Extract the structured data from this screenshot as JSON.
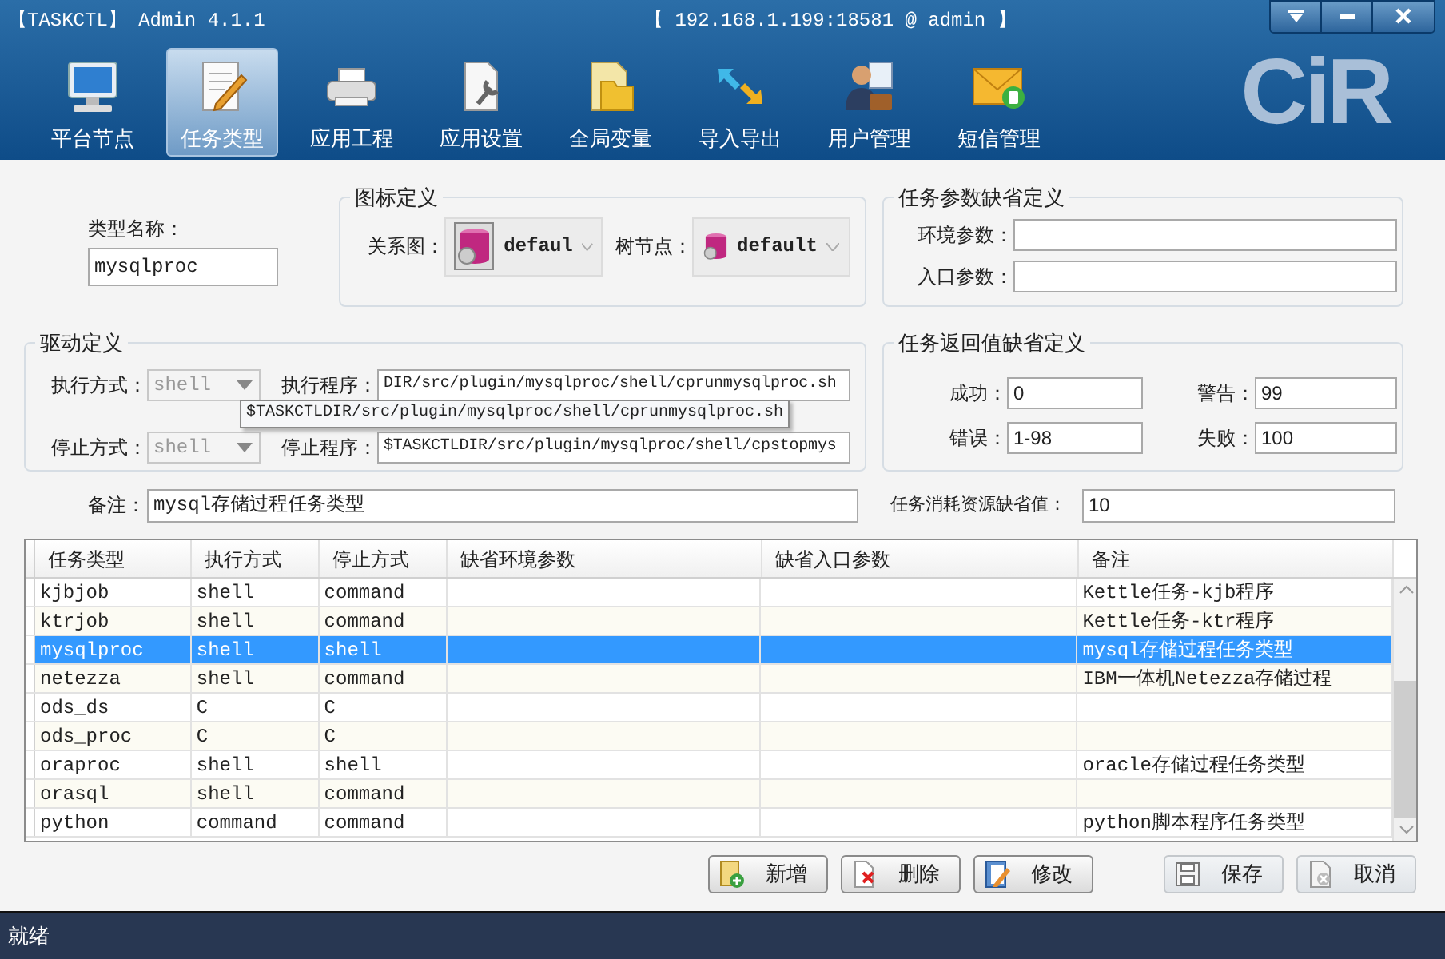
{
  "window": {
    "title": "【TASKCTL】 Admin 4.1.1",
    "connection": "【 192.168.1.199:18581 @ admin 】"
  },
  "logo": "CiR",
  "toolbar": [
    {
      "label": "平台节点",
      "selected": false
    },
    {
      "label": "任务类型",
      "selected": true
    },
    {
      "label": "应用工程",
      "selected": false
    },
    {
      "label": "应用设置",
      "selected": false
    },
    {
      "label": "全局变量",
      "selected": false
    },
    {
      "label": "导入导出",
      "selected": false
    },
    {
      "label": "用户管理",
      "selected": false
    },
    {
      "label": "短信管理",
      "selected": false
    }
  ],
  "type_name": {
    "label": "类型名称：",
    "value": "mysqlproc"
  },
  "icon_definition": {
    "title": "图标定义",
    "relation_label": "关系图：",
    "relation_value": "defaul",
    "tree_label": "树节点：",
    "tree_value": "default"
  },
  "param_defaults": {
    "title": "任务参数缺省定义",
    "fields": [
      {
        "label": "环境参数："
      },
      {
        "label": "入口参数："
      }
    ]
  },
  "driver": {
    "title": "驱动定义",
    "exec_mode": {
      "label": "执行方式：",
      "value": "shell",
      "disabled": true
    },
    "exec_program": {
      "label": "执行程序：",
      "value": "DIR/src/plugin/mysqlproc/shell/cprunmysqlproc.sh"
    },
    "stop_mode": {
      "label": "停止方式：",
      "value": "shell",
      "disabled": true
    },
    "stop_program": {
      "label": "停止程序：",
      "value": "$TASKCTLDIR/src/plugin/mysqlproc/shell/cpstopmys"
    },
    "tooltip": "$TASKCTLDIR/src/plugin/mysqlproc/shell/cprunmysqlproc.sh"
  },
  "return_defaults": {
    "title": "任务返回值缺省定义",
    "fields": [
      {
        "label": "成功：",
        "value": "0"
      },
      {
        "label": "警告：",
        "value": "99"
      },
      {
        "label": "错误：",
        "value": "1-98"
      },
      {
        "label": "失败：",
        "value": "100"
      }
    ]
  },
  "remark": {
    "label": "备注：",
    "value": "mysql存储过程任务类型"
  },
  "resource_default": {
    "label": "任务消耗资源缺省值：",
    "value": "10"
  },
  "table": {
    "columns": [
      "任务类型",
      "执行方式",
      "停止方式",
      "缺省环境参数",
      "缺省入口参数",
      "备注"
    ],
    "rows": [
      {
        "type": "kjbjob",
        "exec": "shell",
        "stop": "command",
        "remark": "Kettle任务-kjb程序",
        "selected": false
      },
      {
        "type": "ktrjob",
        "exec": "shell",
        "stop": "command",
        "remark": "Kettle任务-ktr程序",
        "selected": false
      },
      {
        "type": "mysqlproc",
        "exec": "shell",
        "stop": "shell",
        "remark": "mysql存储过程任务类型",
        "selected": true
      },
      {
        "type": "netezza",
        "exec": "shell",
        "stop": "command",
        "remark": "IBM一体机Netezza存储过程",
        "selected": false
      },
      {
        "type": "ods_ds",
        "exec": "C",
        "stop": "C",
        "selected": false
      },
      {
        "type": "ods_proc",
        "exec": "C",
        "stop": "C",
        "selected": false
      },
      {
        "type": "oraproc",
        "exec": "shell",
        "stop": "shell",
        "remark": "oracle存储过程任务类型",
        "selected": false
      },
      {
        "type": "orasql",
        "exec": "shell",
        "stop": "command",
        "selected": false
      },
      {
        "type": "python",
        "exec": "command",
        "stop": "command",
        "remark": "python脚本程序任务类型",
        "selected": false
      }
    ]
  },
  "buttons": [
    {
      "label": "新增",
      "disabled": false
    },
    {
      "label": "删除",
      "disabled": false
    },
    {
      "label": "修改",
      "disabled": false
    },
    {
      "label": "保存",
      "disabled": true
    },
    {
      "label": "取消",
      "disabled": true
    }
  ],
  "status_bar": "就绪"
}
